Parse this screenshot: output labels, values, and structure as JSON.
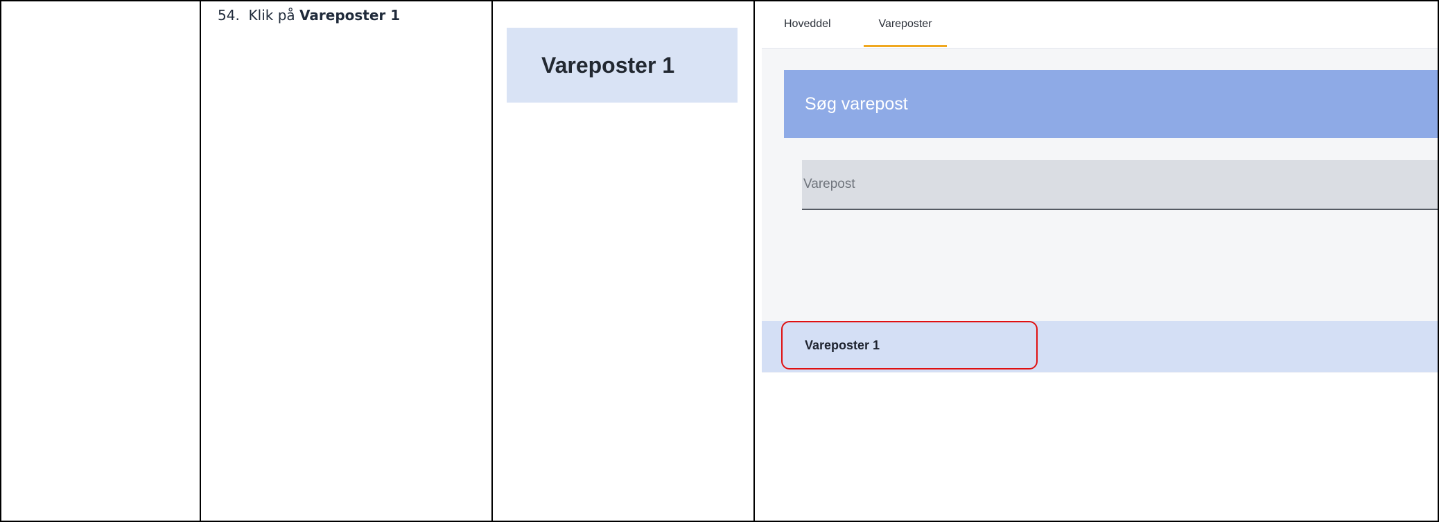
{
  "step": {
    "number": "54.",
    "prefix": "Klik på",
    "target": "Vareposter 1"
  },
  "zoom": {
    "label": "Vareposter 1"
  },
  "app": {
    "tabs": [
      {
        "label": "Hoveddel",
        "active": false
      },
      {
        "label": "Vareposter",
        "active": true
      }
    ],
    "search": {
      "title": "Søg varepost",
      "placeholder": "Varepost",
      "value": ""
    },
    "results": [
      {
        "label": "Vareposter 1"
      }
    ],
    "colors": {
      "tab_active_underline": "#f0a820",
      "search_header_bg": "#8eaae6",
      "result_row_bg": "#d4dff5",
      "highlight_outline": "#e01010"
    }
  }
}
